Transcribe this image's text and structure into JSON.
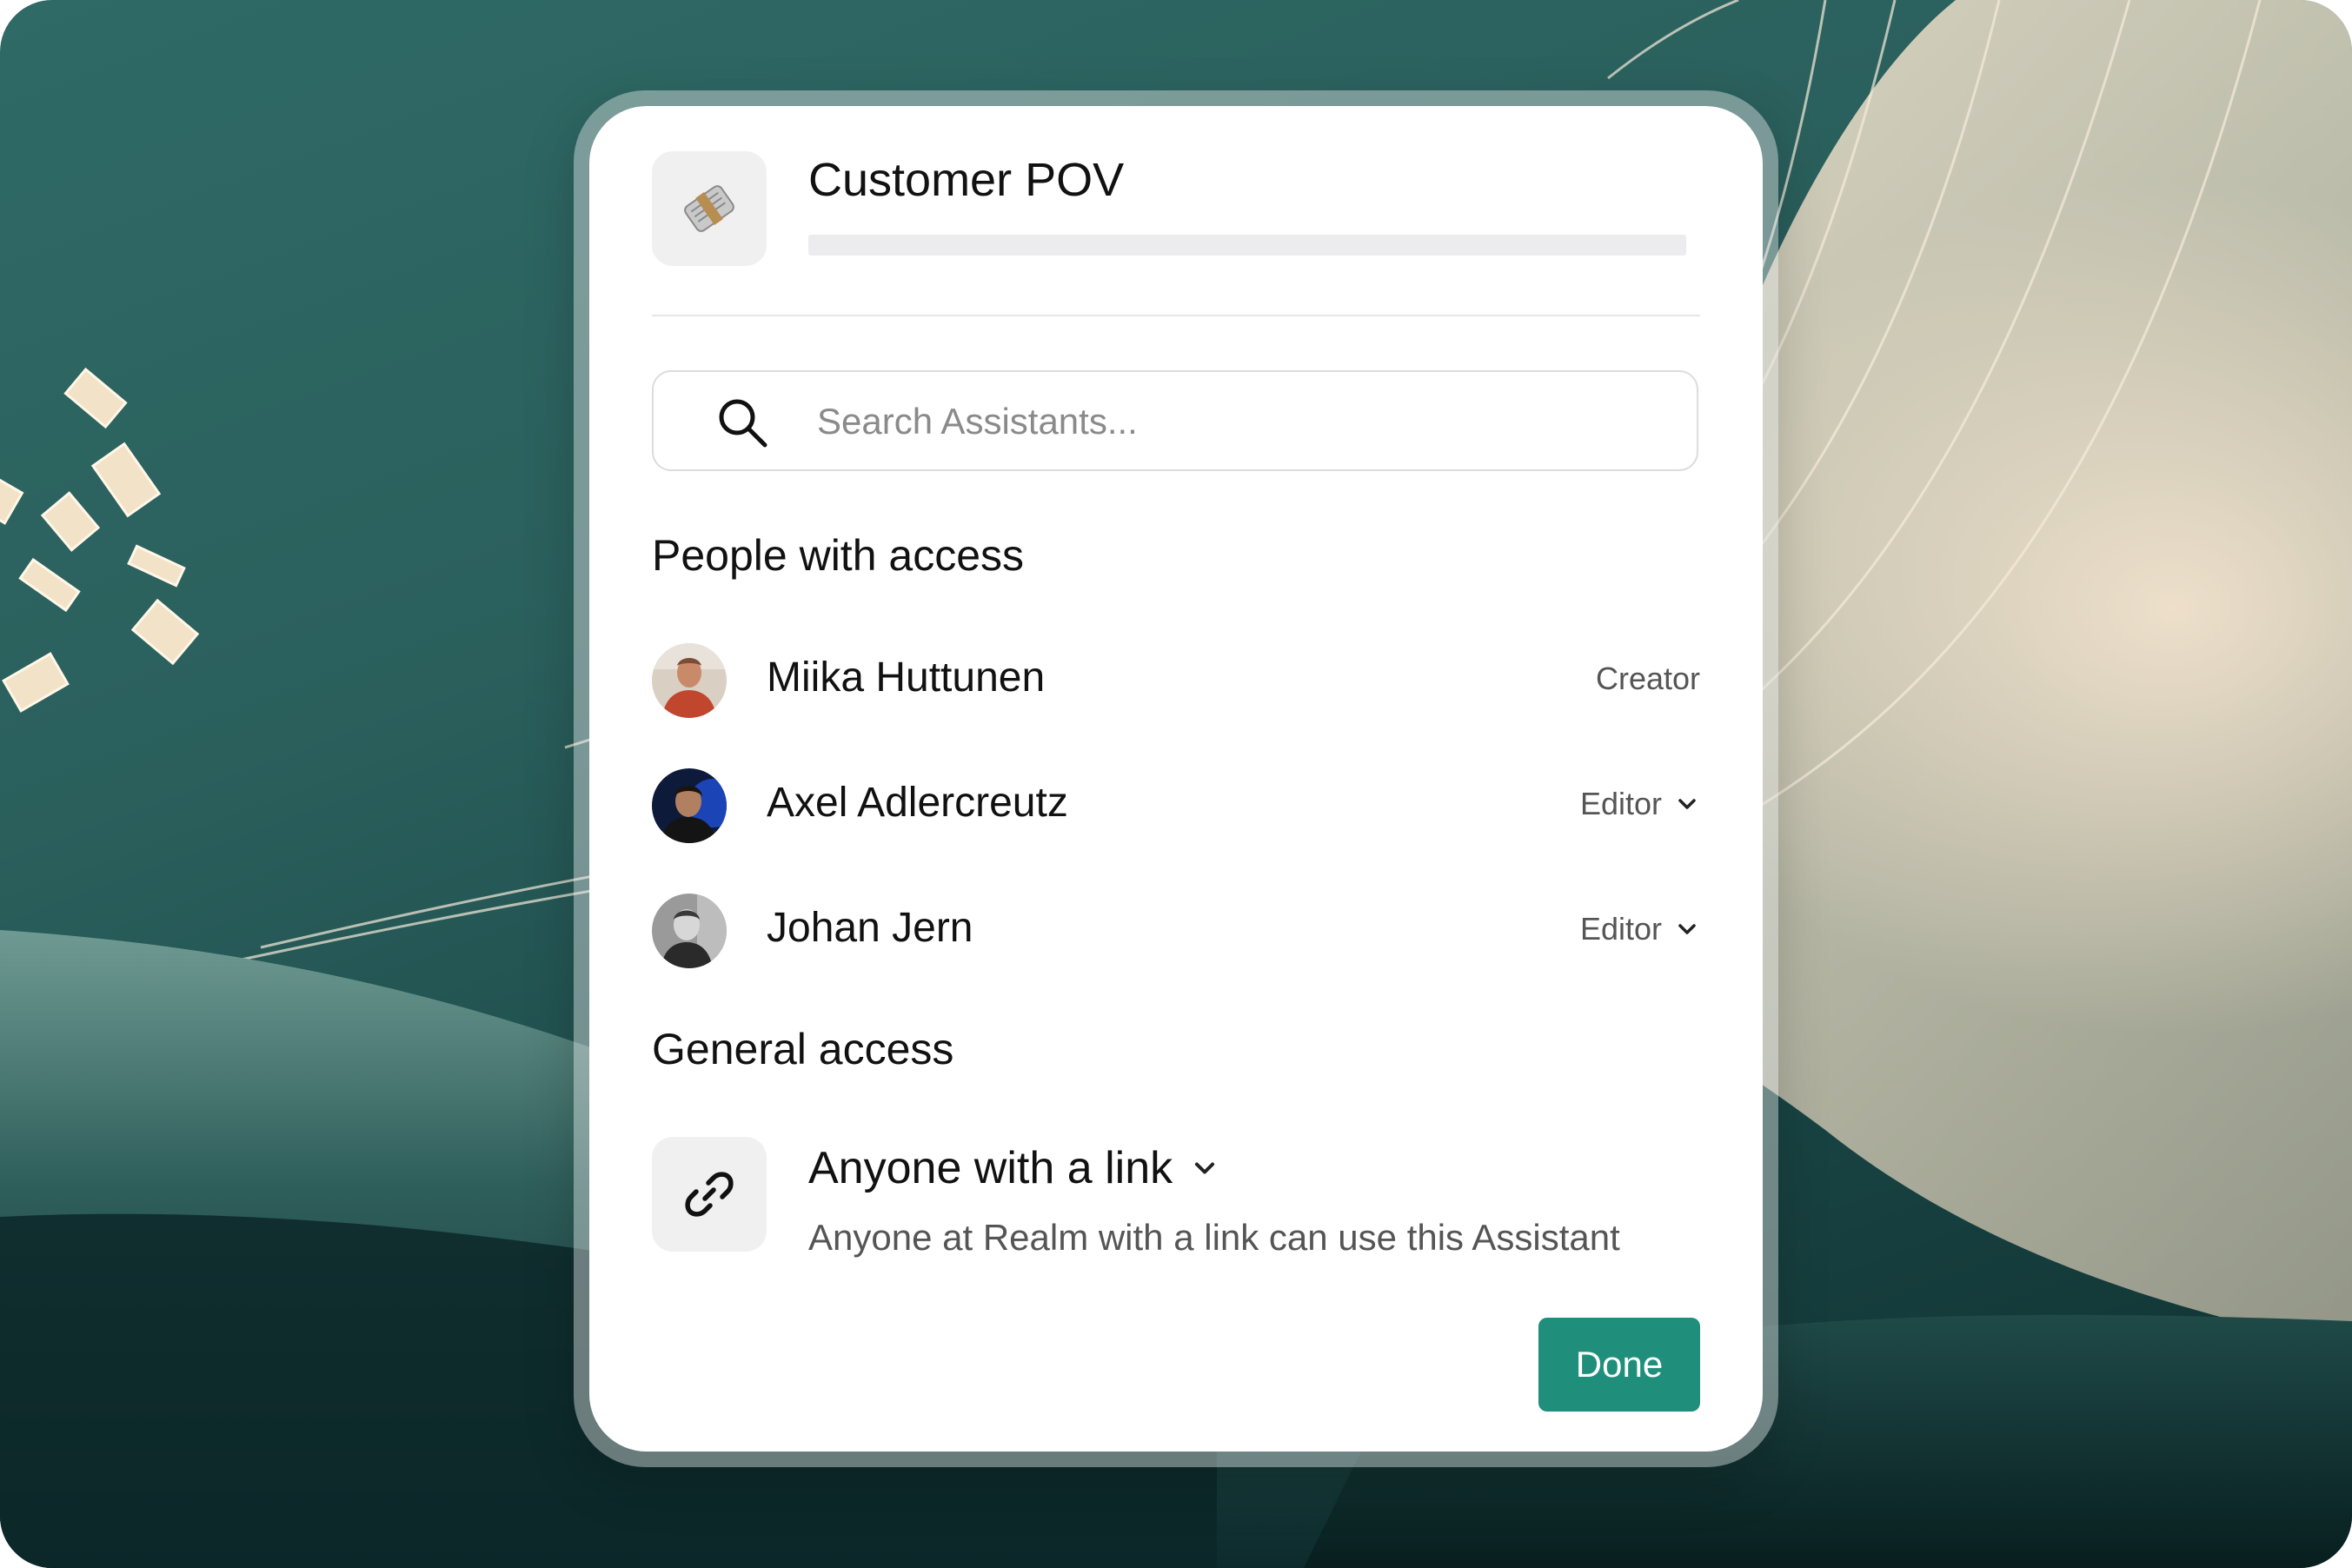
{
  "assistant": {
    "title": "Customer POV",
    "icon": "newspaper-icon"
  },
  "search": {
    "placeholder": "Search Assistants...",
    "value": ""
  },
  "people_section": {
    "title": "People with access",
    "people": [
      {
        "name": "Miika Huttunen",
        "role": "Creator",
        "has_dropdown": false
      },
      {
        "name": "Axel Adlercreutz",
        "role": "Editor",
        "has_dropdown": true
      },
      {
        "name": "Johan Jern",
        "role": "Editor",
        "has_dropdown": true
      }
    ]
  },
  "general_access": {
    "title": "General access",
    "selected_option": "Anyone with a link",
    "description": "Anyone at Realm with a link can use this Assistant",
    "icon": "link-icon"
  },
  "actions": {
    "done_label": "Done"
  },
  "colors": {
    "accent": "#1f8f7c",
    "background_teal": "#2a5f5c"
  }
}
